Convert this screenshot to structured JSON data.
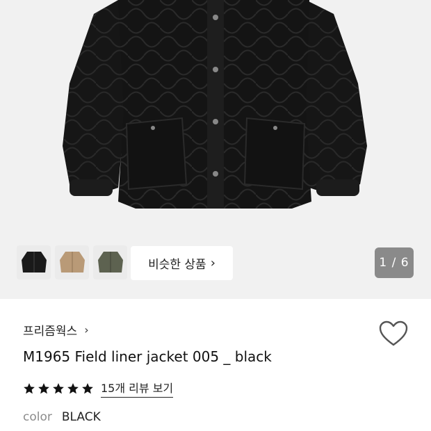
{
  "gallery": {
    "similar_label": "비슷한 상품",
    "similar_chevron": "›",
    "counter": "1 / 6",
    "thumbnails": [
      "black-jacket-thumb",
      "beige-jacket-thumb",
      "olive-jacket-thumb"
    ]
  },
  "product": {
    "brand": "프리즘웍스",
    "brand_chevron": "›",
    "title": "M1965 Field liner jacket 005 _ black",
    "rating_stars": 5,
    "review_link": "15개 리뷰 보기",
    "color_label": "color",
    "color_value": "BLACK"
  },
  "colors": {
    "page_bg": "#ffffff",
    "hero_bg": "#f1f1f1",
    "counter_bg": "#8a8a8a",
    "text": "#222222",
    "muted": "#8c8c8c"
  }
}
